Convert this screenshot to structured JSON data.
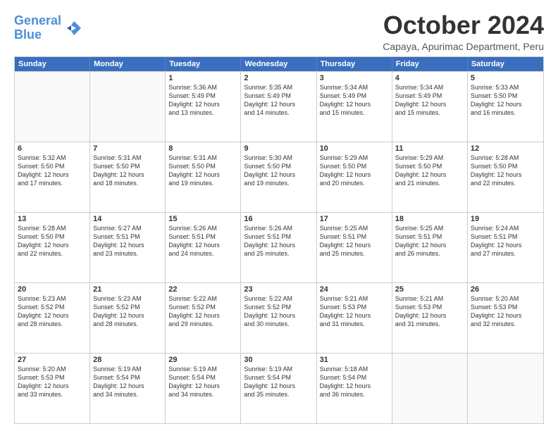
{
  "logo": {
    "line1": "General",
    "line2": "Blue"
  },
  "title": "October 2024",
  "subtitle": "Capaya, Apurimac Department, Peru",
  "header_days": [
    "Sunday",
    "Monday",
    "Tuesday",
    "Wednesday",
    "Thursday",
    "Friday",
    "Saturday"
  ],
  "weeks": [
    [
      {
        "day": "",
        "lines": [],
        "empty": true
      },
      {
        "day": "",
        "lines": [],
        "empty": true
      },
      {
        "day": "1",
        "lines": [
          "Sunrise: 5:36 AM",
          "Sunset: 5:49 PM",
          "Daylight: 12 hours",
          "and 13 minutes."
        ]
      },
      {
        "day": "2",
        "lines": [
          "Sunrise: 5:35 AM",
          "Sunset: 5:49 PM",
          "Daylight: 12 hours",
          "and 14 minutes."
        ]
      },
      {
        "day": "3",
        "lines": [
          "Sunrise: 5:34 AM",
          "Sunset: 5:49 PM",
          "Daylight: 12 hours",
          "and 15 minutes."
        ]
      },
      {
        "day": "4",
        "lines": [
          "Sunrise: 5:34 AM",
          "Sunset: 5:49 PM",
          "Daylight: 12 hours",
          "and 15 minutes."
        ]
      },
      {
        "day": "5",
        "lines": [
          "Sunrise: 5:33 AM",
          "Sunset: 5:50 PM",
          "Daylight: 12 hours",
          "and 16 minutes."
        ]
      }
    ],
    [
      {
        "day": "6",
        "lines": [
          "Sunrise: 5:32 AM",
          "Sunset: 5:50 PM",
          "Daylight: 12 hours",
          "and 17 minutes."
        ]
      },
      {
        "day": "7",
        "lines": [
          "Sunrise: 5:31 AM",
          "Sunset: 5:50 PM",
          "Daylight: 12 hours",
          "and 18 minutes."
        ]
      },
      {
        "day": "8",
        "lines": [
          "Sunrise: 5:31 AM",
          "Sunset: 5:50 PM",
          "Daylight: 12 hours",
          "and 19 minutes."
        ]
      },
      {
        "day": "9",
        "lines": [
          "Sunrise: 5:30 AM",
          "Sunset: 5:50 PM",
          "Daylight: 12 hours",
          "and 19 minutes."
        ]
      },
      {
        "day": "10",
        "lines": [
          "Sunrise: 5:29 AM",
          "Sunset: 5:50 PM",
          "Daylight: 12 hours",
          "and 20 minutes."
        ]
      },
      {
        "day": "11",
        "lines": [
          "Sunrise: 5:29 AM",
          "Sunset: 5:50 PM",
          "Daylight: 12 hours",
          "and 21 minutes."
        ]
      },
      {
        "day": "12",
        "lines": [
          "Sunrise: 5:28 AM",
          "Sunset: 5:50 PM",
          "Daylight: 12 hours",
          "and 22 minutes."
        ]
      }
    ],
    [
      {
        "day": "13",
        "lines": [
          "Sunrise: 5:28 AM",
          "Sunset: 5:50 PM",
          "Daylight: 12 hours",
          "and 22 minutes."
        ]
      },
      {
        "day": "14",
        "lines": [
          "Sunrise: 5:27 AM",
          "Sunset: 5:51 PM",
          "Daylight: 12 hours",
          "and 23 minutes."
        ]
      },
      {
        "day": "15",
        "lines": [
          "Sunrise: 5:26 AM",
          "Sunset: 5:51 PM",
          "Daylight: 12 hours",
          "and 24 minutes."
        ]
      },
      {
        "day": "16",
        "lines": [
          "Sunrise: 5:26 AM",
          "Sunset: 5:51 PM",
          "Daylight: 12 hours",
          "and 25 minutes."
        ]
      },
      {
        "day": "17",
        "lines": [
          "Sunrise: 5:25 AM",
          "Sunset: 5:51 PM",
          "Daylight: 12 hours",
          "and 25 minutes."
        ]
      },
      {
        "day": "18",
        "lines": [
          "Sunrise: 5:25 AM",
          "Sunset: 5:51 PM",
          "Daylight: 12 hours",
          "and 26 minutes."
        ]
      },
      {
        "day": "19",
        "lines": [
          "Sunrise: 5:24 AM",
          "Sunset: 5:51 PM",
          "Daylight: 12 hours",
          "and 27 minutes."
        ]
      }
    ],
    [
      {
        "day": "20",
        "lines": [
          "Sunrise: 5:23 AM",
          "Sunset: 5:52 PM",
          "Daylight: 12 hours",
          "and 28 minutes."
        ]
      },
      {
        "day": "21",
        "lines": [
          "Sunrise: 5:23 AM",
          "Sunset: 5:52 PM",
          "Daylight: 12 hours",
          "and 28 minutes."
        ]
      },
      {
        "day": "22",
        "lines": [
          "Sunrise: 5:22 AM",
          "Sunset: 5:52 PM",
          "Daylight: 12 hours",
          "and 29 minutes."
        ]
      },
      {
        "day": "23",
        "lines": [
          "Sunrise: 5:22 AM",
          "Sunset: 5:52 PM",
          "Daylight: 12 hours",
          "and 30 minutes."
        ]
      },
      {
        "day": "24",
        "lines": [
          "Sunrise: 5:21 AM",
          "Sunset: 5:53 PM",
          "Daylight: 12 hours",
          "and 31 minutes."
        ]
      },
      {
        "day": "25",
        "lines": [
          "Sunrise: 5:21 AM",
          "Sunset: 5:53 PM",
          "Daylight: 12 hours",
          "and 31 minutes."
        ]
      },
      {
        "day": "26",
        "lines": [
          "Sunrise: 5:20 AM",
          "Sunset: 5:53 PM",
          "Daylight: 12 hours",
          "and 32 minutes."
        ]
      }
    ],
    [
      {
        "day": "27",
        "lines": [
          "Sunrise: 5:20 AM",
          "Sunset: 5:53 PM",
          "Daylight: 12 hours",
          "and 33 minutes."
        ]
      },
      {
        "day": "28",
        "lines": [
          "Sunrise: 5:19 AM",
          "Sunset: 5:54 PM",
          "Daylight: 12 hours",
          "and 34 minutes."
        ]
      },
      {
        "day": "29",
        "lines": [
          "Sunrise: 5:19 AM",
          "Sunset: 5:54 PM",
          "Daylight: 12 hours",
          "and 34 minutes."
        ]
      },
      {
        "day": "30",
        "lines": [
          "Sunrise: 5:19 AM",
          "Sunset: 5:54 PM",
          "Daylight: 12 hours",
          "and 35 minutes."
        ]
      },
      {
        "day": "31",
        "lines": [
          "Sunrise: 5:18 AM",
          "Sunset: 5:54 PM",
          "Daylight: 12 hours",
          "and 36 minutes."
        ]
      },
      {
        "day": "",
        "lines": [],
        "empty": true
      },
      {
        "day": "",
        "lines": [],
        "empty": true
      }
    ]
  ]
}
